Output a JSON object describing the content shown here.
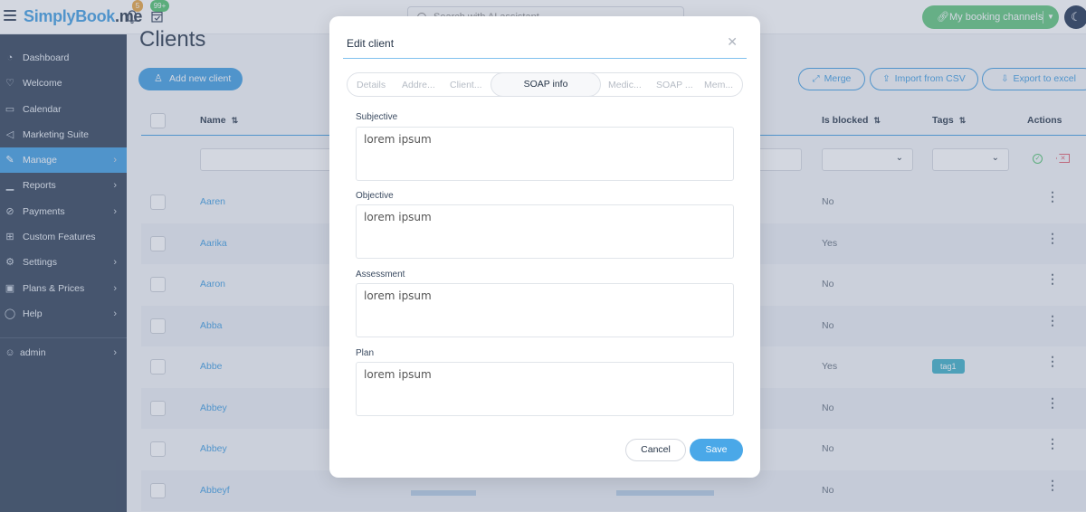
{
  "topbar": {
    "logo_brand": "SimplyBook",
    "logo_tld": ".me",
    "notifications_count": "5",
    "bookings_count": "99+",
    "search_placeholder": "Search with AI assistant",
    "channels_label": "My booking channels",
    "colors": {
      "brand": "#3d9be0",
      "channels": "#5dc47a",
      "notif_badge": "#e6a23c",
      "booking_badge": "#4cc06b"
    }
  },
  "sidebar": {
    "items": [
      {
        "label": "Dashboard",
        "icon": "dashboard-icon",
        "has_arrow": false
      },
      {
        "label": "Welcome",
        "icon": "lightbulb-icon",
        "has_arrow": false
      },
      {
        "label": "Calendar",
        "icon": "calendar-icon",
        "has_arrow": false
      },
      {
        "label": "Marketing Suite",
        "icon": "megaphone-icon",
        "has_arrow": false
      },
      {
        "label": "Manage",
        "icon": "pencil-icon",
        "has_arrow": true,
        "active": true
      },
      {
        "label": "Reports",
        "icon": "chart-icon",
        "has_arrow": true
      },
      {
        "label": "Payments",
        "icon": "payments-icon",
        "has_arrow": true
      },
      {
        "label": "Custom Features",
        "icon": "gift-icon",
        "has_arrow": false
      },
      {
        "label": "Settings",
        "icon": "gear-icon",
        "has_arrow": true
      },
      {
        "label": "Plans & Prices",
        "icon": "money-icon",
        "has_arrow": true
      },
      {
        "label": "Help",
        "icon": "chat-icon",
        "has_arrow": true
      }
    ],
    "user": {
      "label": "admin",
      "icon": "user-icon"
    }
  },
  "main": {
    "title": "Clients",
    "add_button": "Add new client",
    "merge_button": "Merge",
    "import_button": "Import from CSV",
    "export_button": "Export to excel",
    "columns": {
      "name": "Name",
      "is_blocked": "Is blocked",
      "tags": "Tags",
      "actions": "Actions"
    },
    "rows": [
      {
        "name": "Aaren",
        "blocked": "No",
        "tag": ""
      },
      {
        "name": "Aarika",
        "blocked": "Yes",
        "tag": ""
      },
      {
        "name": "Aaron",
        "blocked": "No",
        "tag": ""
      },
      {
        "name": "Abba",
        "blocked": "No",
        "tag": ""
      },
      {
        "name": "Abbe",
        "blocked": "Yes",
        "tag": "tag1"
      },
      {
        "name": "Abbey",
        "blocked": "No",
        "tag": ""
      },
      {
        "name": "Abbey",
        "blocked": "No",
        "tag": ""
      },
      {
        "name": "Abbeyf",
        "blocked": "No",
        "tag": ""
      }
    ]
  },
  "modal": {
    "title": "Edit client",
    "tabs": [
      {
        "label": "Details"
      },
      {
        "label": "Addre..."
      },
      {
        "label": "Client..."
      },
      {
        "label": "SOAP info",
        "active": true
      },
      {
        "label": "Medic..."
      },
      {
        "label": "SOAP ..."
      },
      {
        "label": "Mem..."
      }
    ],
    "fields": [
      {
        "label": "Subjective",
        "value": "lorem ipsum"
      },
      {
        "label": "Objective",
        "value": "lorem ipsum"
      },
      {
        "label": "Assessment",
        "value": "lorem ipsum"
      },
      {
        "label": "Plan",
        "value": "lorem ipsum"
      }
    ],
    "cancel_label": "Cancel",
    "save_label": "Save"
  }
}
